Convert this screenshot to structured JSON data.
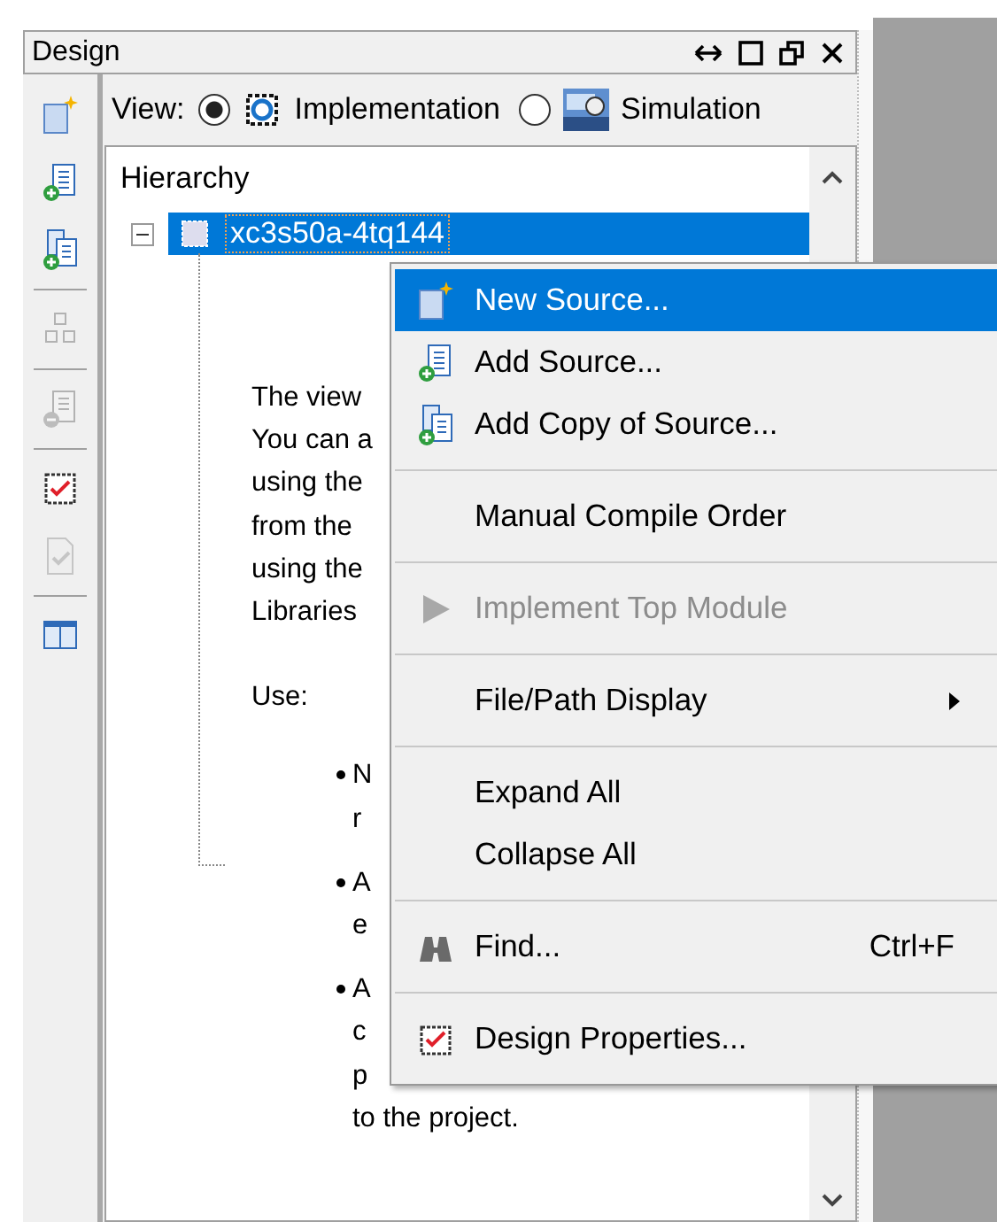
{
  "panel": {
    "title": "Design"
  },
  "toolbar": [
    {
      "kind": "new-source",
      "disabled": false
    },
    {
      "kind": "add-source",
      "disabled": false
    },
    {
      "kind": "add-copy",
      "disabled": false
    },
    {
      "kind": "separator"
    },
    {
      "kind": "chip-grid",
      "disabled": true
    },
    {
      "kind": "separator"
    },
    {
      "kind": "remove-source",
      "disabled": true
    },
    {
      "kind": "separator"
    },
    {
      "kind": "chip-check",
      "disabled": false
    },
    {
      "kind": "doc-check",
      "disabled": true
    },
    {
      "kind": "separator"
    },
    {
      "kind": "table",
      "disabled": false
    }
  ],
  "view": {
    "label": "View:",
    "options": [
      {
        "kind": "implementation",
        "label": "Implementation",
        "selected": true
      },
      {
        "kind": "simulation",
        "label": "Simulation",
        "selected": false
      }
    ]
  },
  "hierarchy": {
    "title": "Hierarchy",
    "tree": [
      {
        "label": "xc3s50a-4tq144",
        "selected": true,
        "expanded": true
      }
    ]
  },
  "help": {
    "intro_lines": [
      "The view",
      "You can a",
      "using the",
      "from the",
      "using the",
      "Libraries"
    ],
    "use_label": "Use:",
    "bullets": [
      {
        "lines": [
          "N",
          "r"
        ]
      },
      {
        "lines": [
          "A",
          "e"
        ]
      },
      {
        "lines": [
          "A",
          "c",
          "p",
          "to the project."
        ]
      }
    ]
  },
  "context_menu": [
    {
      "kind": "new-source",
      "label": "New Source...",
      "selected": true,
      "disabled": false
    },
    {
      "kind": "add-source",
      "label": "Add Source...",
      "selected": false,
      "disabled": false
    },
    {
      "kind": "add-copy",
      "label": "Add Copy of Source...",
      "selected": false,
      "disabled": false
    },
    {
      "kind": "separator"
    },
    {
      "kind": "plain",
      "label": "Manual Compile Order",
      "selected": false,
      "disabled": false
    },
    {
      "kind": "separator"
    },
    {
      "kind": "play",
      "label": "Implement Top Module",
      "selected": false,
      "disabled": true
    },
    {
      "kind": "separator"
    },
    {
      "kind": "plain",
      "label": "File/Path Display",
      "selected": false,
      "disabled": false,
      "submenu": true
    },
    {
      "kind": "separator"
    },
    {
      "kind": "plain",
      "label": "Expand All",
      "selected": false,
      "disabled": false
    },
    {
      "kind": "plain",
      "label": "Collapse All",
      "selected": false,
      "disabled": false
    },
    {
      "kind": "separator"
    },
    {
      "kind": "binoculars",
      "label": "Find...",
      "shortcut": "Ctrl+F",
      "selected": false,
      "disabled": false
    },
    {
      "kind": "separator"
    },
    {
      "kind": "chip-check",
      "label": "Design Properties...",
      "selected": false,
      "disabled": false
    }
  ]
}
